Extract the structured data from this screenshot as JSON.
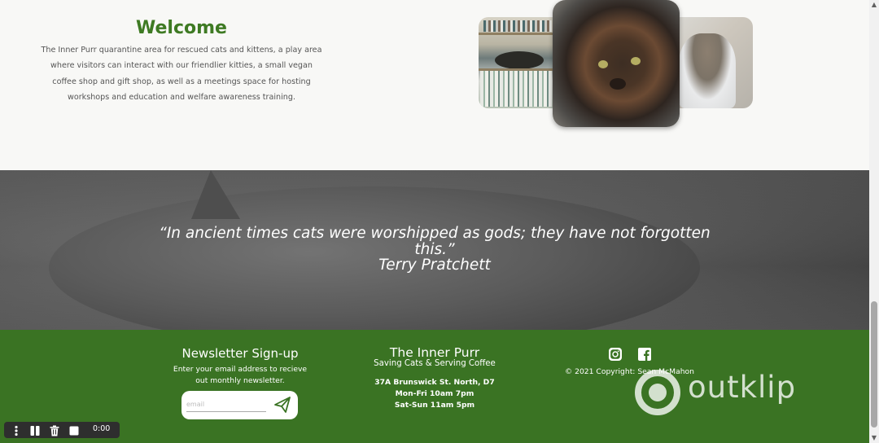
{
  "welcome": {
    "title": "Welcome",
    "lines": [
      "The Inner Purr quarantine area for rescued cats and kittens, a play area",
      "where visitors can interact with our friendlier kitties, a small vegan",
      "coffee shop and gift shop, as well as a meetings space for hosting",
      "workshops and education and welfare awareness training."
    ]
  },
  "quote": {
    "line1": "“In ancient times cats were worshipped as gods; they have not forgotten",
    "line2": "this.”",
    "author": "Terry Pratchett"
  },
  "newsletter": {
    "title": "Newsletter Sign-up",
    "line1": "Enter your email address to recieve",
    "line2": "out monthly newsletter.",
    "email_placeholder": "email",
    "send_icon": "paper-plane-icon"
  },
  "brand": {
    "title": "The Inner Purr",
    "subtitle": "Saving Cats & Serving Coffee",
    "address": "37A Brunswick St. North, D7",
    "hours_weekday": "Mon-Fri 10am 7pm",
    "hours_weekend": "Sat-Sun 11am 5pm"
  },
  "social": {
    "instagram_icon": "instagram-icon",
    "facebook_icon": "facebook-icon",
    "copyright": "© 2021 Copyright: Sean McMahon"
  },
  "watermark": {
    "text": "outklip"
  },
  "recorder": {
    "time": "0:00",
    "icons": [
      "more-icon",
      "pause-icon",
      "trash-icon",
      "stop-icon"
    ]
  },
  "colors": {
    "brand_green": "#3a7323",
    "title_green": "#3e7a23",
    "page_bg": "#f8f8f6"
  }
}
